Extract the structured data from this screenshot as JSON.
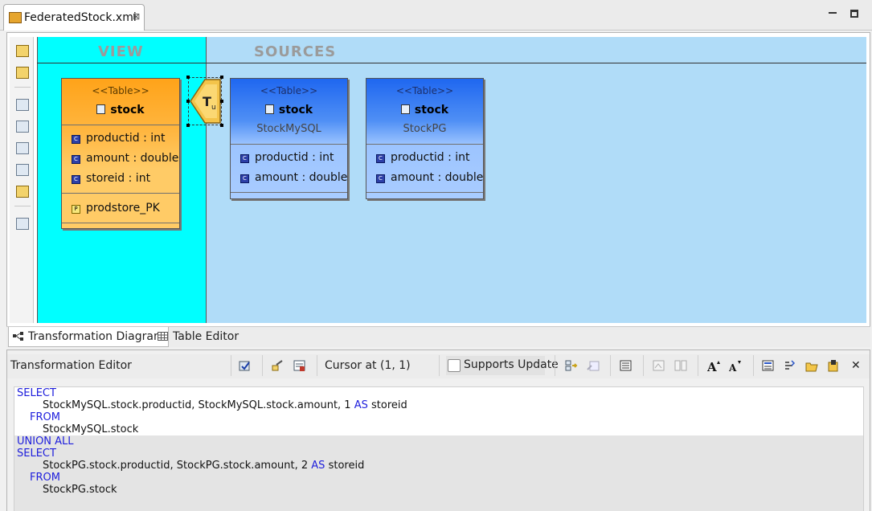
{
  "editor_tab": {
    "title": "FederatedStock.xmi",
    "close": "⊠"
  },
  "diagram": {
    "view_header": "VIEW",
    "sources_header": "SOURCES",
    "view_table": {
      "stereotype": "<<Table>>",
      "name": "stock",
      "columns": [
        "productid : int",
        "amount : double",
        "storeid : int"
      ],
      "keys": [
        "prodstore_PK"
      ]
    },
    "source_tables": [
      {
        "stereotype": "<<Table>>",
        "name": "stock",
        "source": "StockMySQL",
        "columns": [
          "productid : int",
          "amount : double"
        ]
      },
      {
        "stereotype": "<<Table>>",
        "name": "stock",
        "source": "StockPG",
        "columns": [
          "productid : int",
          "amount : double"
        ]
      }
    ],
    "transform_node": {
      "label": "T",
      "sub": "u"
    },
    "tabs": [
      "Transformation Diagram",
      "Table Editor"
    ]
  },
  "transformation_editor": {
    "title": "Transformation Editor",
    "cursor": "Cursor at (1, 1)",
    "supports_update": "Supports Update",
    "supports_update_checked": false,
    "close": "✕",
    "sql_lines": [
      {
        "kw": "SELECT",
        "text": ""
      },
      {
        "kw": "",
        "text": "StockMySQL.stock.productid, StockMySQL.stock.amount, 1 ",
        "kw2": "AS",
        "tail": " storeid"
      },
      {
        "kw": "FROM",
        "text": ""
      },
      {
        "kw": "",
        "text": "StockMySQL.stock"
      },
      {
        "kw": "UNION ALL",
        "text": ""
      },
      {
        "kw": "SELECT",
        "text": ""
      },
      {
        "kw": "",
        "text": "StockPG.stock.productid, StockPG.stock.amount, 2 ",
        "kw2": "AS",
        "tail": " storeid"
      },
      {
        "kw": "FROM",
        "text": ""
      },
      {
        "kw": "",
        "text": "StockPG.stock"
      }
    ]
  },
  "colors": {
    "view_bg": "#00ffff",
    "sources_bg": "#b0dcf8",
    "keyword": "#1e1edc",
    "view_table": "#ffb640",
    "source_table": "#4f8ff5"
  }
}
